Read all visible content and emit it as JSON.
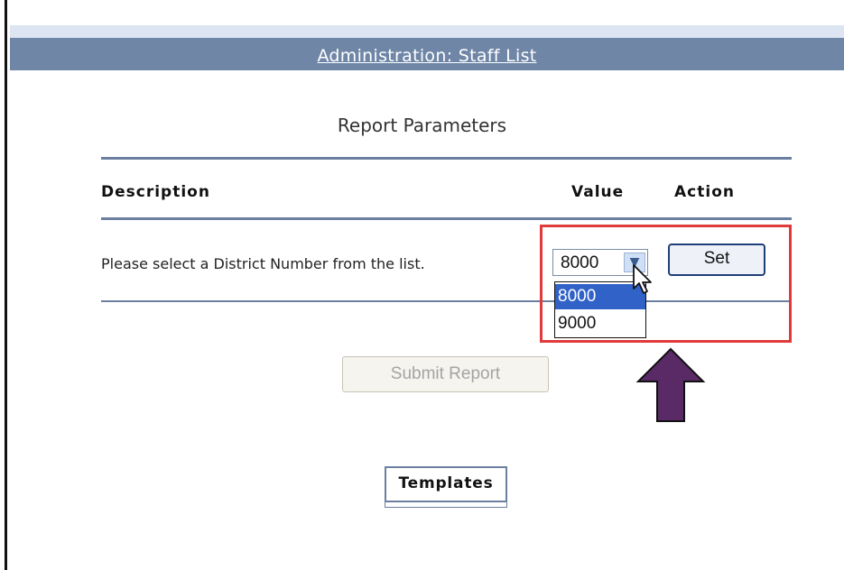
{
  "header": {
    "title": "Administration: Staff List"
  },
  "report": {
    "title": "Report Parameters"
  },
  "table": {
    "columns": [
      "Description",
      "Value",
      "Action"
    ],
    "rows": [
      {
        "description": "Please select a District Number from the list."
      }
    ]
  },
  "district_select": {
    "selected": "8000",
    "options": [
      "8000",
      "9000"
    ]
  },
  "set_button": {
    "label": "Set"
  },
  "submit_button": {
    "label": "Submit Report"
  },
  "templates": {
    "label": "Templates"
  },
  "colors": {
    "header_bar": "#6f86a6",
    "highlight": "#e03a3a",
    "arrow": "#5a2a66",
    "selected_option": "#3162c8"
  },
  "icons": [
    "chevron-down-icon",
    "cursor-arrow-icon",
    "up-arrow-icon"
  ]
}
